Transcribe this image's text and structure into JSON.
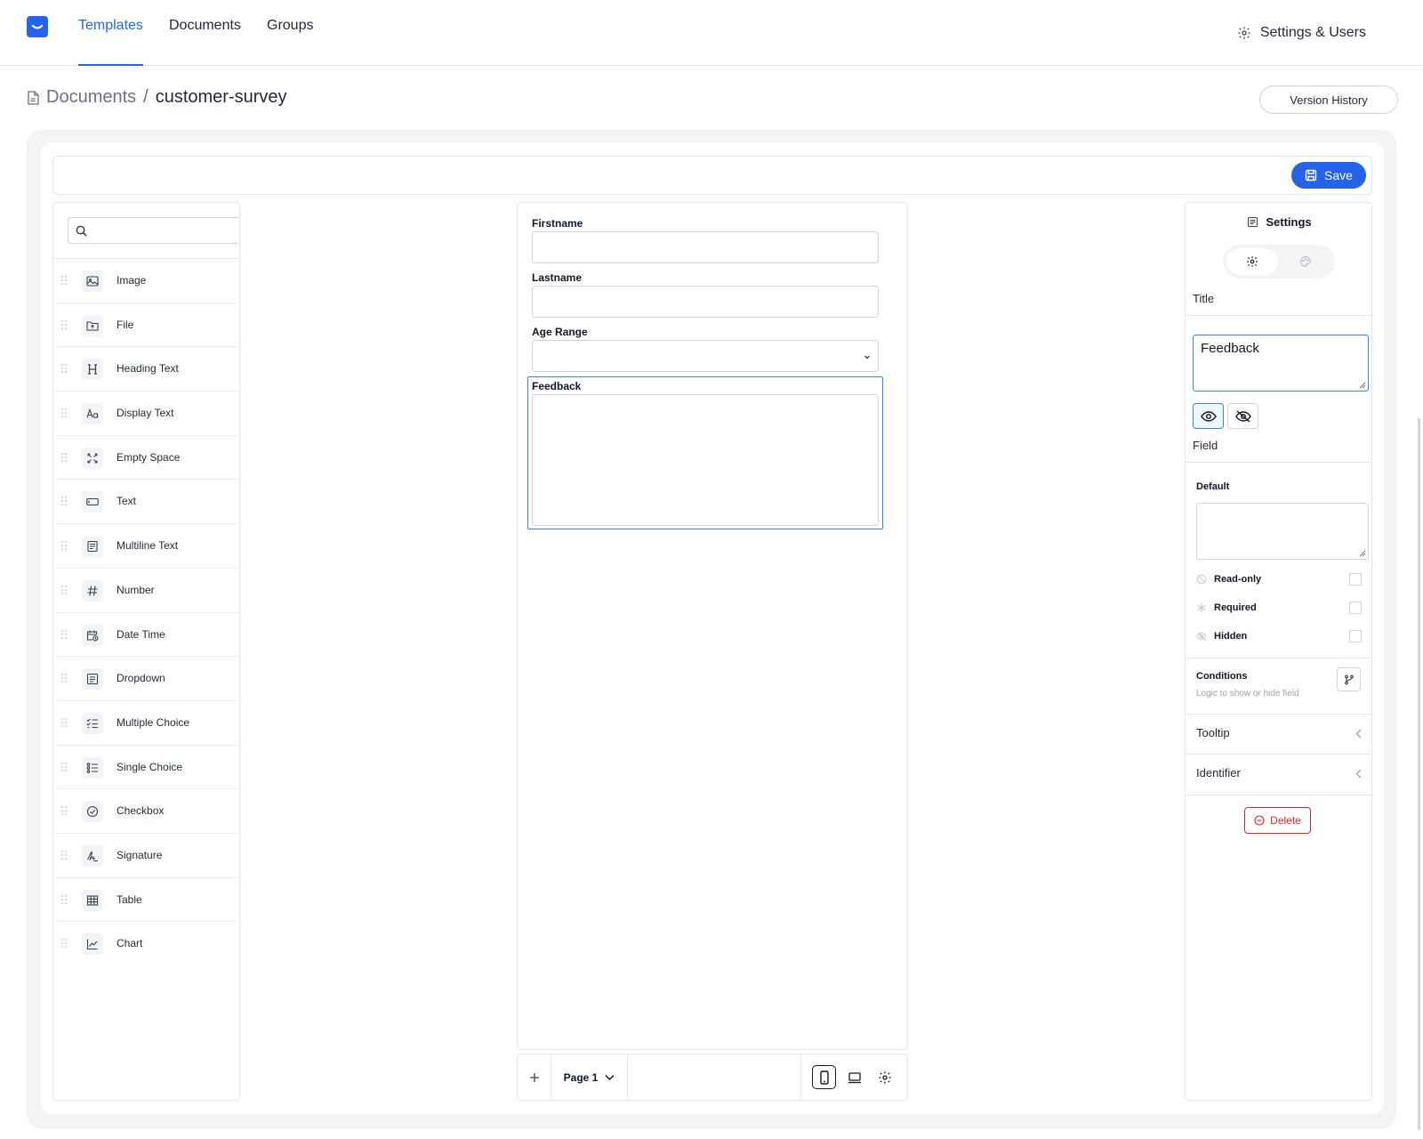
{
  "nav": {
    "tabs": [
      "Templates",
      "Documents",
      "Groups"
    ],
    "active_tab": "Templates",
    "settings_label": "Settings & Users"
  },
  "breadcrumb": {
    "parent": "Documents",
    "separator": "/",
    "current": "customer-survey"
  },
  "version_history_label": "Version History",
  "toolbar": {
    "save_label": "Save"
  },
  "palette": {
    "search_placeholder": "",
    "items": [
      {
        "label": "Image",
        "icon": "image-icon"
      },
      {
        "label": "File",
        "icon": "file-upload-icon"
      },
      {
        "label": "Heading Text",
        "icon": "heading-icon"
      },
      {
        "label": "Display Text",
        "icon": "display-text-icon"
      },
      {
        "label": "Empty Space",
        "icon": "empty-space-icon"
      },
      {
        "label": "Text",
        "icon": "text-input-icon"
      },
      {
        "label": "Multiline Text",
        "icon": "multiline-text-icon"
      },
      {
        "label": "Number",
        "icon": "hash-icon"
      },
      {
        "label": "Date Time",
        "icon": "calendar-clock-icon"
      },
      {
        "label": "Dropdown",
        "icon": "dropdown-icon"
      },
      {
        "label": "Multiple Choice",
        "icon": "checklist-icon"
      },
      {
        "label": "Single Choice",
        "icon": "radio-list-icon"
      },
      {
        "label": "Checkbox",
        "icon": "check-circle-icon"
      },
      {
        "label": "Signature",
        "icon": "signature-icon"
      },
      {
        "label": "Table",
        "icon": "table-icon"
      },
      {
        "label": "Chart",
        "icon": "chart-icon"
      }
    ]
  },
  "canvas": {
    "fields": [
      {
        "label": "Firstname",
        "type": "text"
      },
      {
        "label": "Lastname",
        "type": "text"
      },
      {
        "label": "Age Range",
        "type": "select"
      },
      {
        "label": "Feedback",
        "type": "textarea",
        "selected": true
      }
    ],
    "page_label": "Page 1",
    "active_view": "mobile"
  },
  "settings": {
    "title": "Settings",
    "active_tab": "general",
    "title_section": "Title",
    "title_value": "Feedback",
    "title_visible": true,
    "field_section": "Field",
    "default_label": "Default",
    "default_value": "",
    "options": [
      {
        "label": "Read-only",
        "icon": "read-only-icon",
        "checked": false
      },
      {
        "label": "Required",
        "icon": "asterisk-icon",
        "checked": false
      },
      {
        "label": "Hidden",
        "icon": "hidden-icon",
        "checked": false
      }
    ],
    "conditions_title": "Conditions",
    "conditions_desc": "Logic to show or hide field",
    "accordions": [
      "Tooltip",
      "Identifier"
    ],
    "delete_label": "Delete"
  },
  "colors": {
    "accent": "#2563eb",
    "selection": "#3b82f6",
    "danger": "#dc2626"
  }
}
